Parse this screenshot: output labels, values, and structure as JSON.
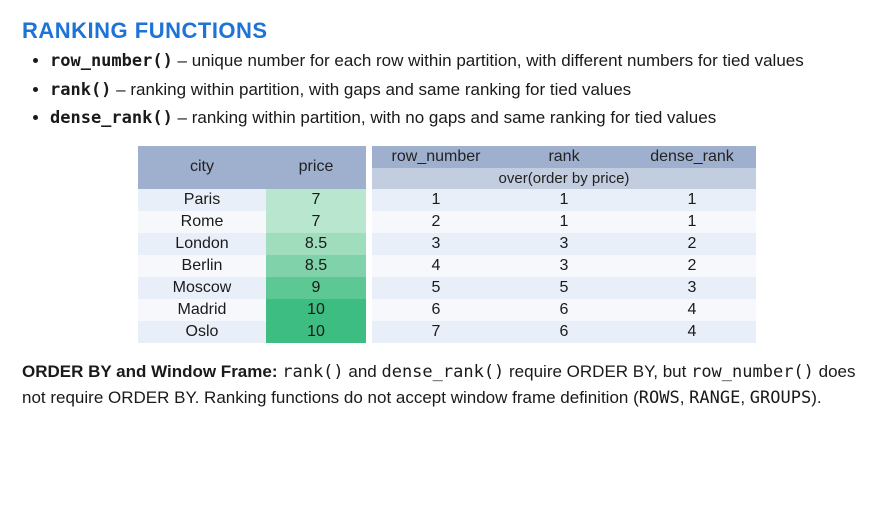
{
  "heading": "RANKING FUNCTIONS",
  "functions": [
    {
      "name": "row_number()",
      "desc": " – unique number for each row within partition, with different numbers for tied values"
    },
    {
      "name": "rank()",
      "desc": " – ranking within partition, with gaps and same ranking for tied values"
    },
    {
      "name": "dense_rank()",
      "desc": " – ranking within partition, with no gaps and same ranking for tied values"
    }
  ],
  "table": {
    "headers": {
      "city": "city",
      "price": "price",
      "row_number": "row_number",
      "rank": "rank",
      "dense_rank": "dense_rank"
    },
    "subheader": "over(order by price)",
    "rows": [
      {
        "city": "Paris",
        "price": "7",
        "row_number": "1",
        "rank": "1",
        "dense_rank": "1",
        "shade": "p1"
      },
      {
        "city": "Rome",
        "price": "7",
        "row_number": "2",
        "rank": "1",
        "dense_rank": "1",
        "shade": "p1"
      },
      {
        "city": "London",
        "price": "8.5",
        "row_number": "3",
        "rank": "3",
        "dense_rank": "2",
        "shade": "p2"
      },
      {
        "city": "Berlin",
        "price": "8.5",
        "row_number": "4",
        "rank": "3",
        "dense_rank": "2",
        "shade": "p3"
      },
      {
        "city": "Moscow",
        "price": "9",
        "row_number": "5",
        "rank": "5",
        "dense_rank": "3",
        "shade": "p4"
      },
      {
        "city": "Madrid",
        "price": "10",
        "row_number": "6",
        "rank": "6",
        "dense_rank": "4",
        "shade": "p5"
      },
      {
        "city": "Oslo",
        "price": "10",
        "row_number": "7",
        "rank": "6",
        "dense_rank": "4",
        "shade": "p5"
      }
    ]
  },
  "note": {
    "lead": "ORDER BY and Window Frame: ",
    "p1a": "rank()",
    "p1b": " and ",
    "p1c": "dense_rank()",
    "p1d": " require ORDER BY, but ",
    "p1e": "row_number()",
    "p1f": " does not require ORDER BY. Ranking functions do not accept window frame definition (",
    "p1g": "ROWS",
    "p1h": ", ",
    "p1i": "RANGE",
    "p1j": ", ",
    "p1k": "GROUPS",
    "p1l": ")."
  }
}
